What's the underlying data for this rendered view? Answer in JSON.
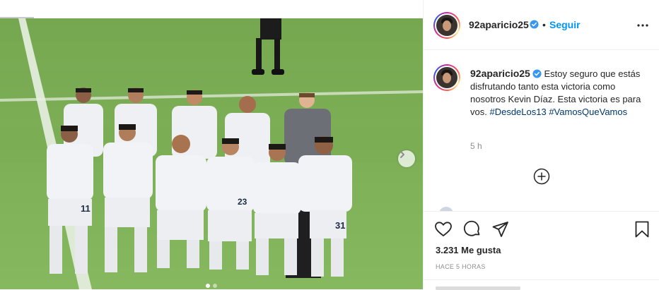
{
  "post": {
    "username": "92aparicio25",
    "separator": "•",
    "follow_label": "Seguir",
    "caption_text": "Estoy seguro que estás disfrutando tanto esta victoria como nosotros Kevin Díaz. Esta victoria es para vos.",
    "hashtags": [
      "#DesdeLos13",
      "#VamosQueVamos"
    ],
    "comment_time": "5 h",
    "likes": "3.231 Me gusta",
    "posted_ago": "HACE 5 HORAS"
  },
  "carousel": {
    "current": 1,
    "total": 2
  },
  "jersey_numbers": [
    "11",
    "23",
    "31"
  ],
  "colors": {
    "accent": "#0095f6",
    "hashtag": "#00376b",
    "pitch": "#7fb15a",
    "kit": "#eef0f3"
  },
  "icons": [
    "verified-badge-icon",
    "more-options-icon",
    "add-comment-icon",
    "heart-icon",
    "comment-icon",
    "share-icon",
    "bookmark-icon",
    "chevron-right-icon"
  ]
}
